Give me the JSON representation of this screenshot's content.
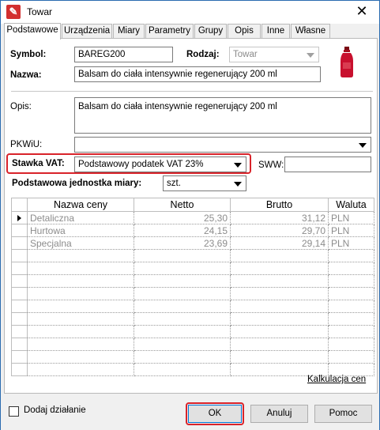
{
  "window": {
    "title": "Towar"
  },
  "tabs": [
    {
      "label": "Podstawowe"
    },
    {
      "label": "Urządzenia"
    },
    {
      "label": "Miary"
    },
    {
      "label": "Parametry"
    },
    {
      "label": "Grupy"
    },
    {
      "label": "Opis"
    },
    {
      "label": "Inne"
    },
    {
      "label": "Własne"
    }
  ],
  "form": {
    "symbol_label": "Symbol:",
    "symbol_value": "BAREG200",
    "rodzaj_label": "Rodzaj:",
    "rodzaj_value": "Towar",
    "nazwa_label": "Nazwa:",
    "nazwa_value": "Balsam do ciała intensywnie regenerujący 200 ml",
    "opis_label": "Opis:",
    "opis_value": "Balsam do ciała intensywnie regenerujący 200 ml",
    "pkwiu_label": "PKWiU:",
    "pkwiu_value": "",
    "vat_label": "Stawka VAT:",
    "vat_value": "Podstawowy podatek VAT 23%",
    "sww_label": "SWW:",
    "sww_value": "",
    "unit_label": "Podstawowa jednostka miary:",
    "unit_value": "szt."
  },
  "prices": {
    "columns": [
      "Nazwa ceny",
      "Netto",
      "Brutto",
      "Waluta"
    ],
    "rows": [
      {
        "name": "Detaliczna",
        "netto": "25,30",
        "brutto": "31,12",
        "currency": "PLN"
      },
      {
        "name": "Hurtowa",
        "netto": "24,15",
        "brutto": "29,70",
        "currency": "PLN"
      },
      {
        "name": "Specjalna",
        "netto": "23,69",
        "brutto": "29,14",
        "currency": "PLN"
      }
    ]
  },
  "links": {
    "kalkulacja": "Kalkulacja cen"
  },
  "footer": {
    "add_action_label": "Dodaj działanie",
    "ok_label": "OK",
    "cancel_label": "Anuluj",
    "help_label": "Pomoc"
  },
  "colors": {
    "highlight": "#d9232a",
    "product_red": "#c8102e"
  }
}
